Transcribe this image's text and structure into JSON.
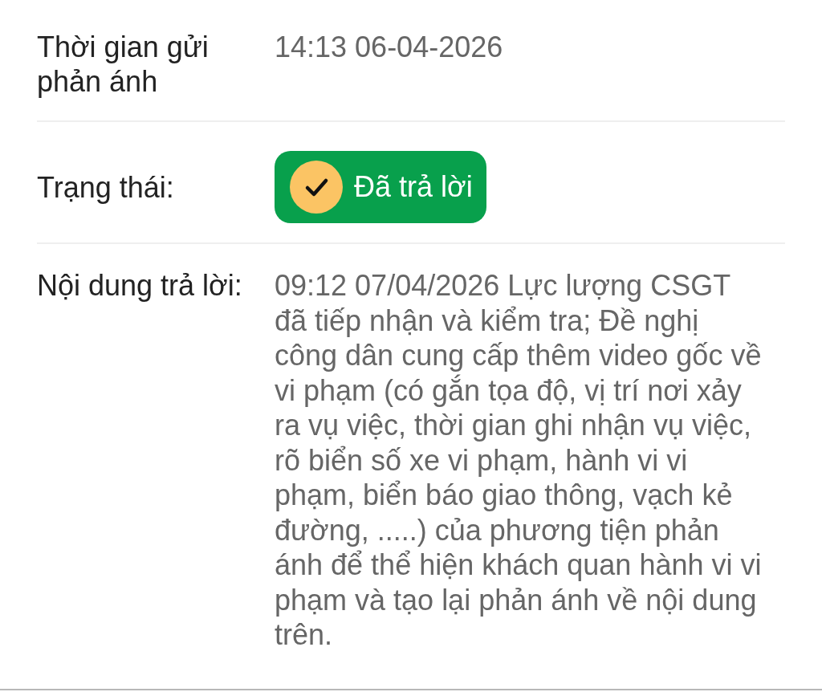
{
  "rows": [
    {
      "kind": "text",
      "label": "Thời gian gửi phản ánh",
      "value": "14:13 06-04-2026"
    },
    {
      "kind": "status",
      "label": "Trạng thái:",
      "value": "Đã trả lời"
    },
    {
      "kind": "text",
      "label": "Nội dung trả lời:",
      "value": "09:12 07/04/2026 Lực lượng CSGT đã tiếp nhận và kiểm tra; Đề nghị công dân cung cấp thêm video gốc về vi phạm (có gắn tọa độ, vị trí nơi xảy ra vụ việc, thời gian ghi nhận vụ việc, rõ biển số xe vi phạm, hành vi vi phạm, biển báo giao thông, vạch kẻ đường, .....) của phương tiện phản ánh để thể hiện khách quan hành vi vi phạm và tạo lại phản ánh về nội dung trên."
    }
  ]
}
